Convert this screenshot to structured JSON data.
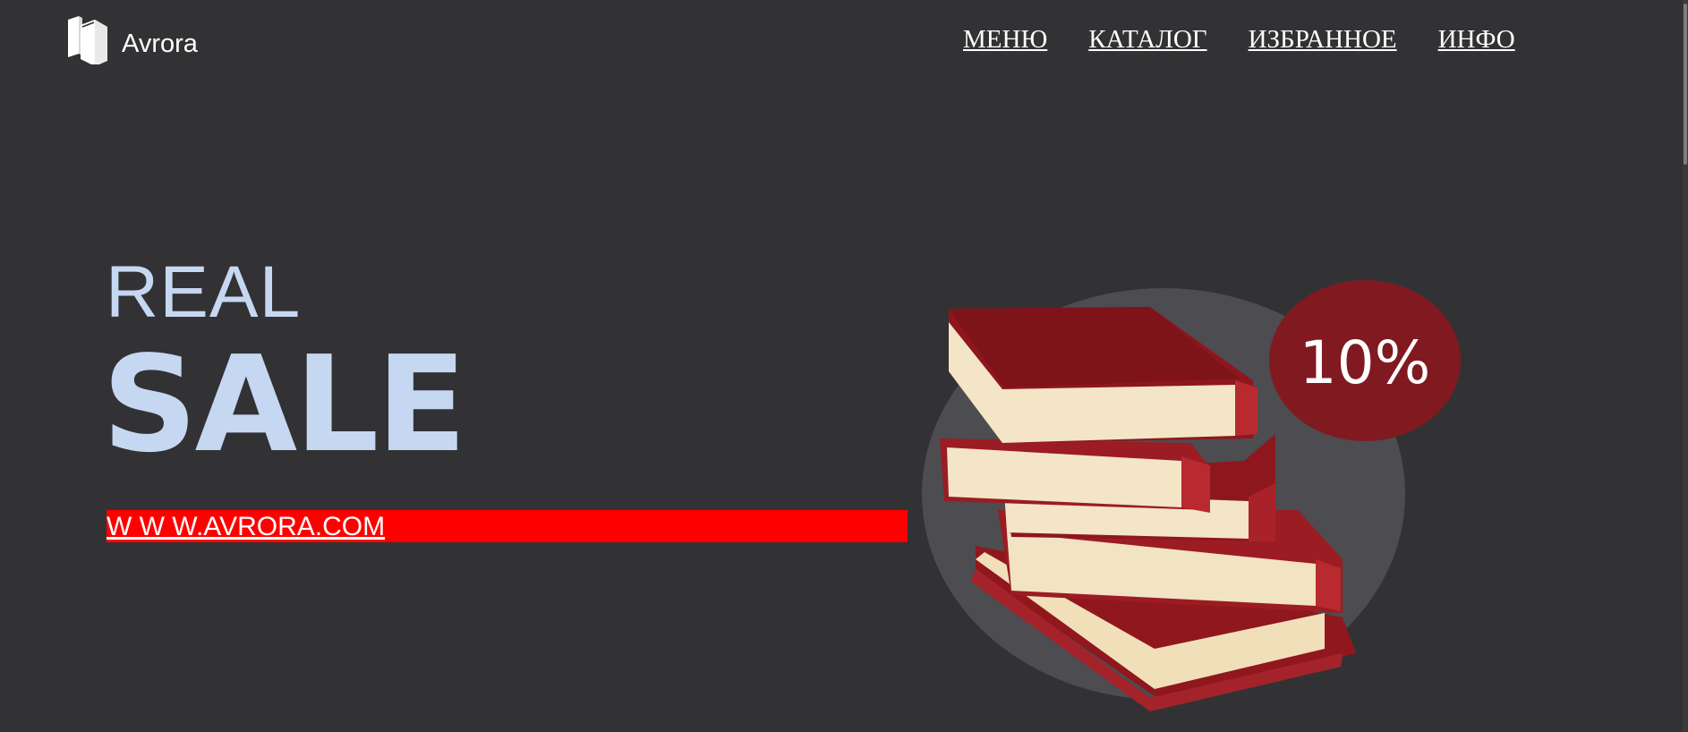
{
  "header": {
    "logo_text": "Avrora",
    "logo_icon": "books-icon",
    "nav": [
      {
        "label": "МЕНЮ"
      },
      {
        "label": "КАТАЛОГ"
      },
      {
        "label": "ИЗБРАННОЕ"
      },
      {
        "label": "ИНФО"
      }
    ]
  },
  "hero": {
    "kicker": "REAL",
    "headline": "SALE",
    "url_text": "W W W.AVRORA.COM",
    "discount": "10%"
  },
  "colors": {
    "background": "#323234",
    "headline": "#c6d7f2",
    "url_bar": "#ff0000",
    "badge": "#801a20",
    "book_cover": "#9b1c22",
    "book_pages": "#f4e6c8"
  }
}
